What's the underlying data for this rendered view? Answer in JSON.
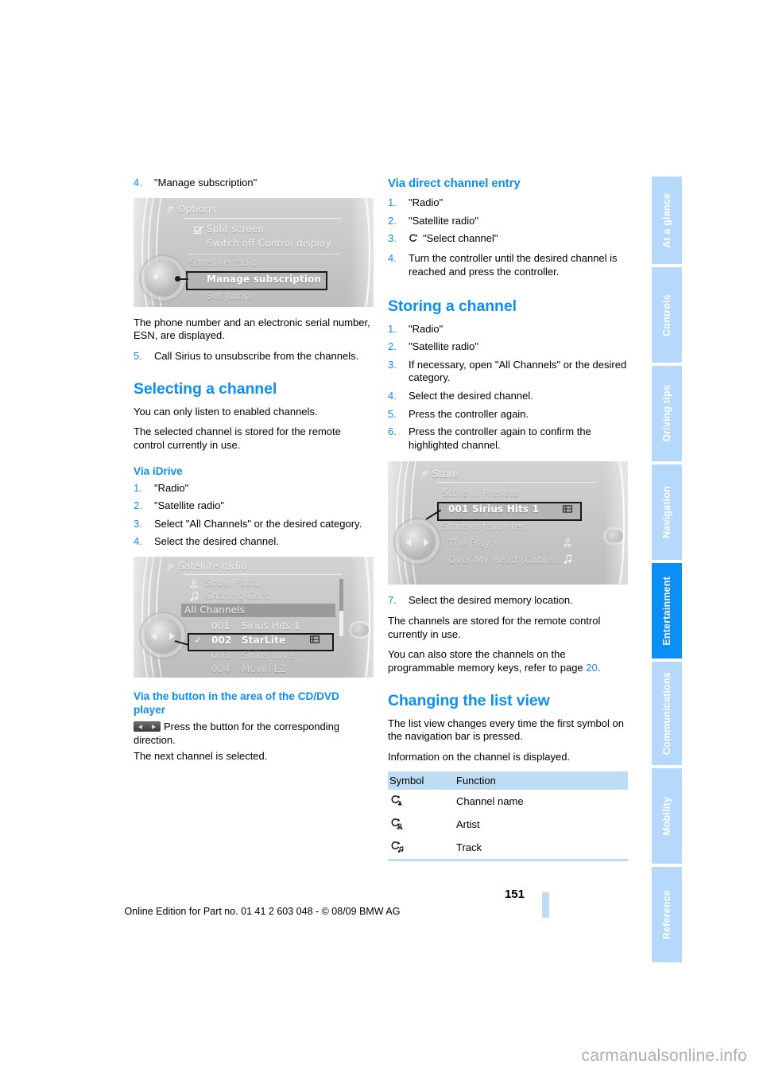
{
  "document": {
    "page_number": "151",
    "edition_line": "Online Edition for Part no. 01 41 2 603 048 - © 08/09 BMW AG",
    "watermark": "carmanualsonline.info",
    "accent_blue": "#0b8ff5",
    "tab_blue_inactive": "#b6d9fb",
    "table_header_blue": "#bfdcf5"
  },
  "sidebar": {
    "tabs": [
      {
        "label": "At a glance",
        "active": false
      },
      {
        "label": "Controls",
        "active": false
      },
      {
        "label": "Driving tips",
        "active": false
      },
      {
        "label": "Navigation",
        "active": false
      },
      {
        "label": "Entertainment",
        "active": true
      },
      {
        "label": "Communications",
        "active": false
      },
      {
        "label": "Mobility",
        "active": false
      },
      {
        "label": "Reference",
        "active": false
      }
    ]
  },
  "left_column": {
    "step4": {
      "num": "4.",
      "text": "\"Manage subscription\""
    },
    "options_screenshot": {
      "title": "Options",
      "title_icon": "satellite-radio-icon",
      "rows": [
        {
          "label": "Split screen",
          "icon": "checkbox-checked-icon",
          "state": "normal"
        },
        {
          "label": "Switch off Control display",
          "icon": "",
          "state": "normal"
        },
        {
          "label": "Satellite radio",
          "icon": "",
          "state": "dim"
        },
        {
          "label": "Manage subscription",
          "icon": "",
          "state": "selected"
        },
        {
          "label": "Set Jump",
          "icon": "",
          "state": "dim"
        }
      ]
    },
    "para_esn": "The phone number and an electronic serial number, ESN, are displayed.",
    "step5": {
      "num": "5.",
      "text": "Call Sirius to unsubscribe from the channels."
    },
    "heading_selecting": "Selecting a channel",
    "para_enabled": "You can only listen to enabled channels.",
    "para_stored": "The selected channel is stored for the remote control currently in use.",
    "heading_via_idrive": "Via iDrive",
    "idrive_steps": [
      {
        "num": "1.",
        "text": "\"Radio\""
      },
      {
        "num": "2.",
        "text": "\"Satellite radio\""
      },
      {
        "num": "3.",
        "text": "Select \"All Channels\" or the desired category."
      },
      {
        "num": "4.",
        "text": "Select the desired channel."
      }
    ],
    "satellite_screenshot": {
      "title": "Satellite radio",
      "title_icon": "satellite-radio-icon",
      "info_rows": [
        {
          "icon": "artist-icon",
          "label": "Snow Patrol"
        },
        {
          "icon": "track-icon",
          "label": "Chasing Cars"
        }
      ],
      "group_header": "All Channels",
      "channels": [
        {
          "check": "",
          "number": "001",
          "name": "Sirius Hits 1",
          "trailing_icon": "",
          "state": "normal"
        },
        {
          "check": "✓",
          "number": "002",
          "name": "StarLite",
          "trailing_icon": "preset-icon",
          "state": "selected"
        },
        {
          "check": "",
          "number": "003",
          "name": "Sirius Love",
          "trailing_icon": "",
          "state": "normal"
        },
        {
          "check": "",
          "number": "004",
          "name": "Movin EZ",
          "trailing_icon": "",
          "state": "normal"
        }
      ]
    },
    "heading_via_button": "Via the button in the area of the CD/DVD player",
    "button_glyph_name": "seek-buttons-icon",
    "para_press_button": "Press the button for the corresponding direction.",
    "para_next_channel": "The next channel is selected."
  },
  "right_column": {
    "heading_direct_entry": "Via direct channel entry",
    "direct_entry_steps": [
      {
        "num": "1.",
        "text": "\"Radio\""
      },
      {
        "num": "2.",
        "text": "\"Satellite radio\""
      },
      {
        "num": "3.",
        "text": "\"Select channel\"",
        "icon": "select-channel-icon"
      },
      {
        "num": "4.",
        "text": "Turn the controller until the desired channel is reached and press the controller."
      }
    ],
    "heading_storing": "Storing a channel",
    "storing_steps": [
      {
        "num": "1.",
        "text": "\"Radio\""
      },
      {
        "num": "2.",
        "text": "\"Satellite radio\""
      },
      {
        "num": "3.",
        "text": "If necessary, open \"All Channels\" or the desired category."
      },
      {
        "num": "4.",
        "text": "Select the desired channel."
      },
      {
        "num": "5.",
        "text": "Press the controller again."
      },
      {
        "num": "6.",
        "text": "Press the controller again to confirm the highlighted channel."
      }
    ],
    "store_screenshot": {
      "title": "Store",
      "title_icon": "satellite-radio-icon",
      "presets_header": "Store in Presets",
      "preset_row": {
        "number": "001",
        "name": "Sirius Hits 1",
        "trailing_icon": "preset-icon"
      },
      "favorites_header": "Store in favorites",
      "favorites": [
        {
          "label": "The Fray;",
          "trailing_icon": "artist-icon"
        },
        {
          "label": "Over My Head (Cable...",
          "trailing_icon": "track-icon"
        }
      ]
    },
    "step7": {
      "num": "7.",
      "text": "Select the desired memory location."
    },
    "para_channels_stored": "The channels are stored for the remote control currently in use.",
    "para_memory_keys_pre": "You can also store the channels on the programmable memory keys, refer to page ",
    "para_memory_keys_ref": "20",
    "para_memory_keys_post": ".",
    "heading_list_view": "Changing the list view",
    "para_list_view": "The list view changes every time the first symbol on the navigation bar is pressed.",
    "para_info_channel": "Information on the channel is displayed.",
    "symbol_table": {
      "headers": [
        "Symbol",
        "Function"
      ],
      "rows": [
        {
          "symbol_name": "channel-name-icon",
          "function": "Channel name"
        },
        {
          "symbol_name": "artist-icon",
          "function": "Artist"
        },
        {
          "symbol_name": "track-icon",
          "function": "Track"
        }
      ]
    }
  }
}
